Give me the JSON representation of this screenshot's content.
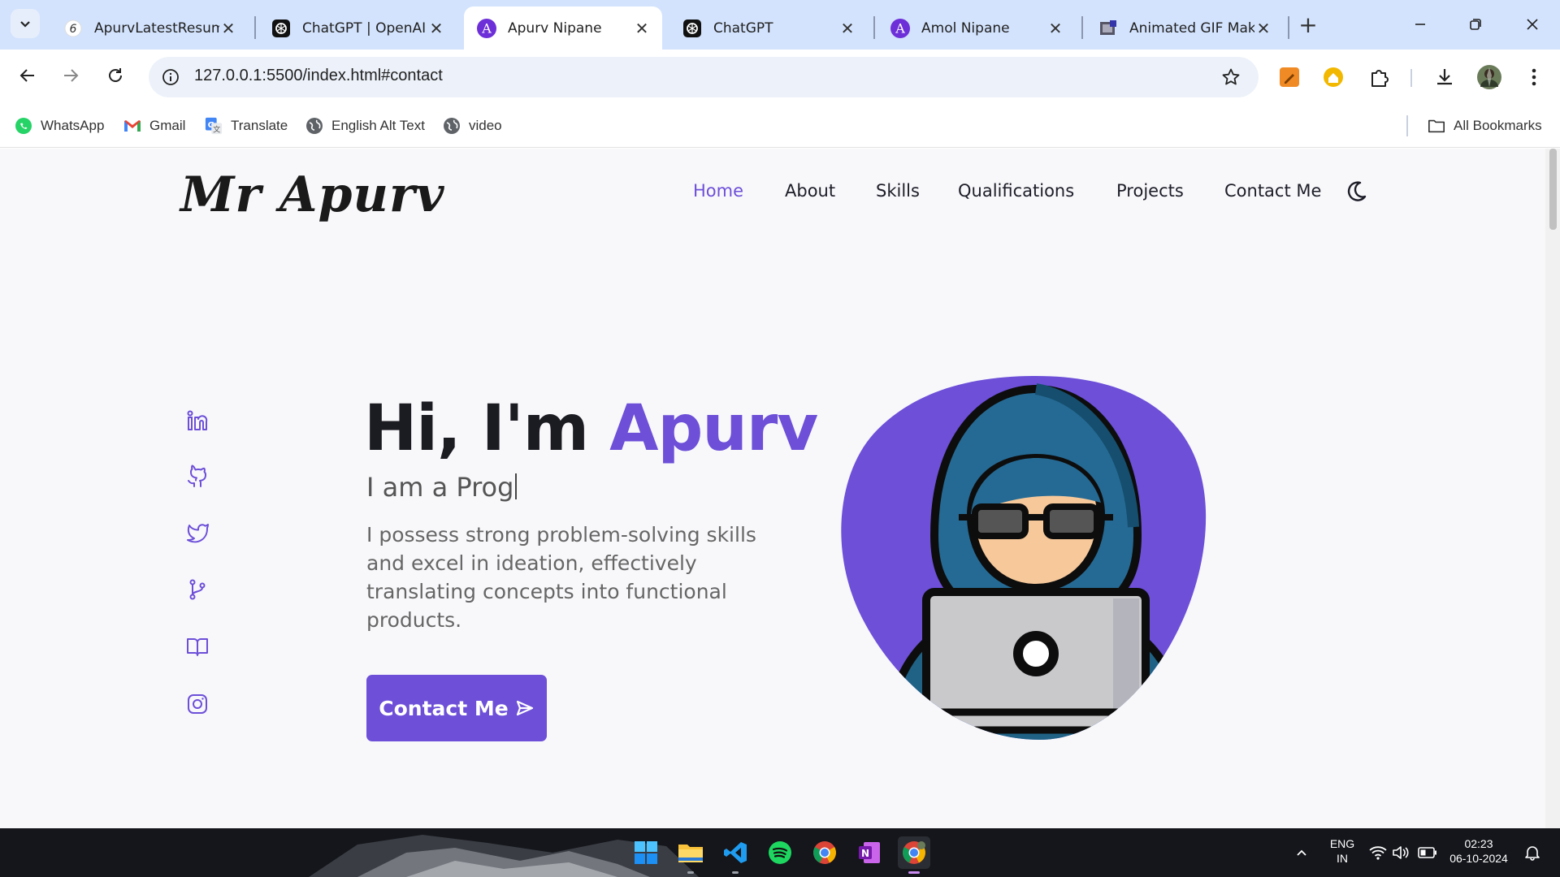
{
  "browser": {
    "tabs": [
      {
        "title": "ApurvLatestResume",
        "icon": "resume-favicon"
      },
      {
        "title": "ChatGPT | OpenAI",
        "icon": "openai-favicon"
      },
      {
        "title": "Apurv Nipane",
        "icon": "purple-a-favicon",
        "active": true
      },
      {
        "title": "ChatGPT",
        "icon": "openai-favicon"
      },
      {
        "title": "Amol Nipane",
        "icon": "purple-a-favicon"
      },
      {
        "title": "Animated GIF Maker",
        "icon": "gif-maker-favicon"
      }
    ],
    "url": "127.0.0.1:5500/index.html#contact",
    "bookmarks": [
      {
        "label": "WhatsApp",
        "icon": "whatsapp-icon"
      },
      {
        "label": "Gmail",
        "icon": "gmail-icon"
      },
      {
        "label": "Translate",
        "icon": "translate-icon"
      },
      {
        "label": "English Alt Text",
        "icon": "globe-icon"
      },
      {
        "label": "video",
        "icon": "globe-icon"
      }
    ],
    "all_bookmarks": "All Bookmarks"
  },
  "site": {
    "logo": "Mr Apurv",
    "nav": [
      "Home",
      "About",
      "Skills",
      "Qualifications",
      "Projects",
      "Contact Me"
    ],
    "active_nav": "Home",
    "hero": {
      "greeting": "Hi, I'm ",
      "name": "Apurv",
      "subtitle": "I am a Prog",
      "description": "I possess strong problem-solving skills and excel in ideation, effectively translating concepts into functional products.",
      "cta_label": "Contact Me"
    },
    "social_icons": [
      "linkedin-icon",
      "github-icon",
      "twitter-icon",
      "git-branch-icon",
      "book-icon",
      "instagram-icon"
    ]
  },
  "taskbar": {
    "apps": [
      "windows-start-icon",
      "file-explorer-icon",
      "vscode-icon",
      "spotify-icon",
      "chrome-icon",
      "onenote-icon",
      "chrome-profile-icon"
    ],
    "lang_top": "ENG",
    "lang_bottom": "IN",
    "time": "02:23",
    "date": "06-10-2024"
  },
  "colors": {
    "accent": "#6d4fd8",
    "tabstrip": "#d3e3fd",
    "page_bg": "#f8f8fb"
  }
}
